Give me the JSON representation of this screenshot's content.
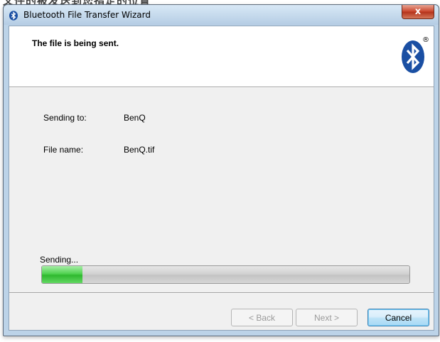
{
  "caption": "文件的被发送到您指定的位置",
  "window": {
    "title": "Bluetooth File Transfer Wizard",
    "close_glyph": "x"
  },
  "header": {
    "title": "The file is being sent.",
    "logo_registered": "®"
  },
  "details": {
    "sending_to_label": "Sending to:",
    "sending_to_value": "BenQ",
    "file_name_label": "File name:",
    "file_name_value": "BenQ.tif"
  },
  "progress": {
    "label": "Sending...",
    "fraction": 0.11
  },
  "buttons": {
    "back": "< Back",
    "next": "Next >",
    "cancel": "Cancel"
  },
  "colors": {
    "progress_green": "#3cc43c",
    "bluetooth_blue": "#1a4fa3"
  }
}
